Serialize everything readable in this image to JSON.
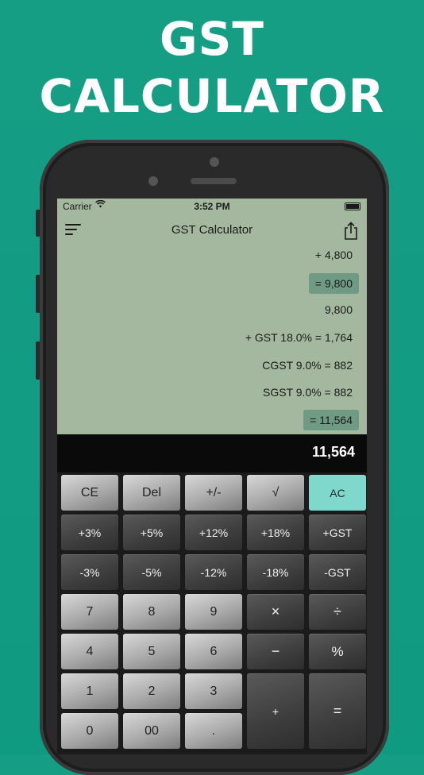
{
  "promo": {
    "line1": "GST",
    "line2": "CALCULATOR"
  },
  "status_bar": {
    "carrier": "Carrier",
    "time": "3:52 PM"
  },
  "nav": {
    "title": "GST Calculator"
  },
  "tape": [
    {
      "text": "+ 4,800",
      "highlight": false
    },
    {
      "text": "= 9,800",
      "highlight": true
    },
    {
      "text": "9,800",
      "highlight": false
    },
    {
      "text": "+ GST 18.0% = 1,764",
      "highlight": false
    },
    {
      "text": "CGST 9.0% = 882",
      "highlight": false
    },
    {
      "text": "SGST 9.0% = 882",
      "highlight": false
    },
    {
      "text": "= 11,564",
      "highlight": true
    }
  ],
  "result": {
    "value": "11,564"
  },
  "keys": {
    "ce": "CE",
    "del": "Del",
    "sign": "+/-",
    "sqrt": "√",
    "ac": "AC",
    "p3": "+3%",
    "p5": "+5%",
    "p12": "+12%",
    "p18": "+18%",
    "pgst": "+GST",
    "m3": "-3%",
    "m5": "-5%",
    "m12": "-12%",
    "m18": "-18%",
    "mgst": "-GST",
    "k7": "7",
    "k8": "8",
    "k9": "9",
    "mul": "×",
    "div": "÷",
    "k4": "4",
    "k5": "5",
    "k6": "6",
    "sub": "−",
    "pct": "%",
    "k1": "1",
    "k2": "2",
    "k3": "3",
    "add": "+",
    "eq": "=",
    "k0": "0",
    "k00": "00",
    "dot": "."
  },
  "colors": {
    "background": "#169e84",
    "display": "#a4b89f",
    "highlight": "#6f9b84",
    "ac_key": "#7fd8cb"
  },
  "icons": {
    "menu": "sort-lines-icon",
    "share": "share-icon",
    "wifi": "wifi-icon",
    "battery": "battery-icon"
  }
}
